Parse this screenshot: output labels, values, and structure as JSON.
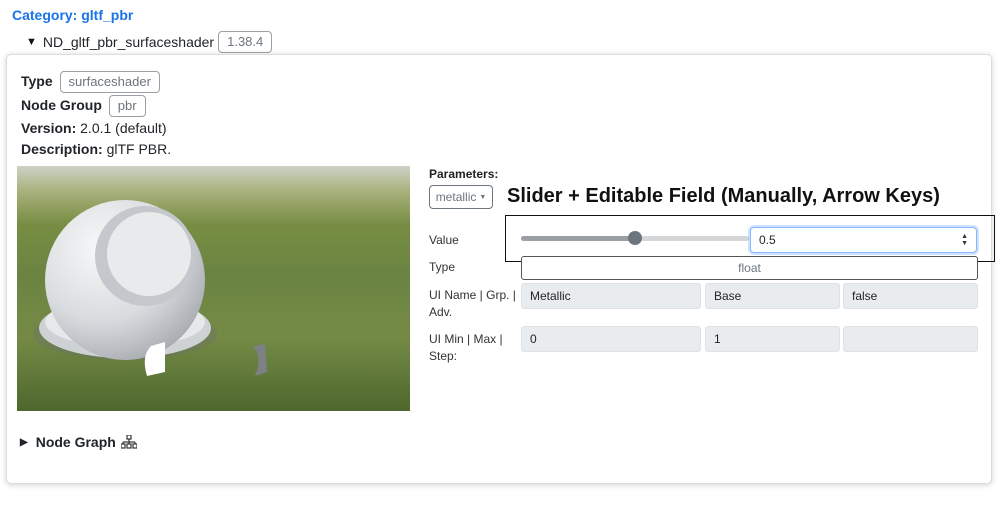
{
  "category": "Category: gltf_pbr",
  "node": {
    "name": "ND_gltf_pbr_surfaceshader",
    "version_badge": "1.38.4"
  },
  "meta": {
    "type_label": "Type",
    "type_value": "surfaceshader",
    "group_label": "Node Group",
    "group_value": "pbr",
    "version_label": "Version:",
    "version_value": "2.0.1 (default)",
    "description_label": "Description:",
    "description_value": "glTF PBR."
  },
  "parameters": {
    "title": "Parameters:",
    "selected": "metallic",
    "headline": "Slider + Editable Field (Manually, Arrow Keys)",
    "value_label": "Value",
    "value": "0.5",
    "slider_fraction": 0.5,
    "type_label": "Type",
    "type_value": "float",
    "ui_name_label": "UI Name | Grp. | Adv.",
    "ui_name": "Metallic",
    "ui_group": "Base",
    "ui_advanced": "false",
    "ui_minmax_label": "UI Min | Max | Step:",
    "ui_min": "0",
    "ui_max": "1",
    "ui_step": ""
  },
  "node_graph_label": "Node Graph",
  "colors": {
    "accent": "#1a73e8",
    "slider_thumb": "#6c757d",
    "readonly_bg": "#e9ecef"
  }
}
